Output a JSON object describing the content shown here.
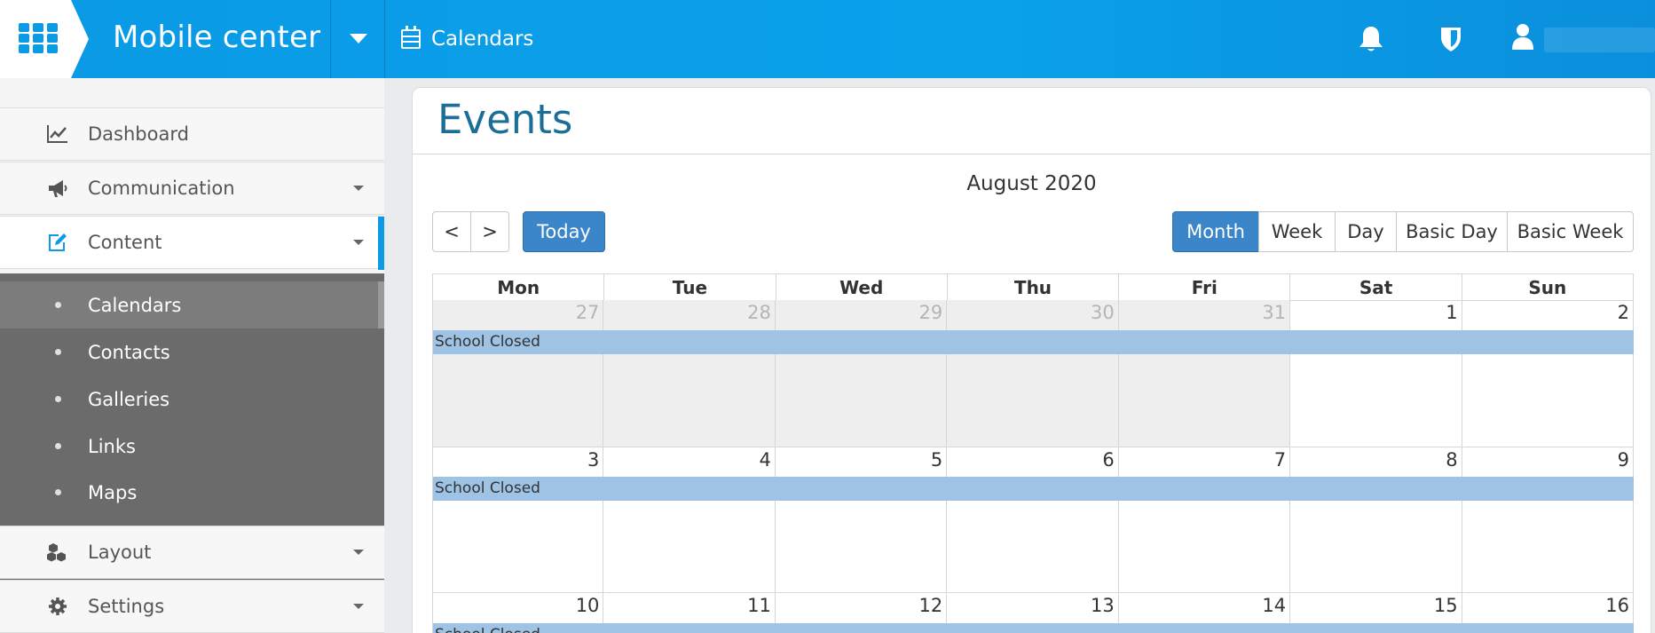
{
  "app": {
    "title": "Mobile center"
  },
  "header": {
    "breadcrumb": "Calendars",
    "icons": [
      "apps-grid-icon",
      "calendar-icon",
      "bell-icon",
      "shield-icon",
      "user-icon"
    ]
  },
  "sidebar": {
    "items": [
      {
        "label": "Dashboard",
        "icon": "line-chart-icon"
      },
      {
        "label": "Communication",
        "icon": "megaphone-icon"
      },
      {
        "label": "Content",
        "icon": "edit-icon"
      },
      {
        "label": "Layout",
        "icon": "cubes-icon"
      },
      {
        "label": "Settings",
        "icon": "gear-icon"
      }
    ],
    "subitems": [
      "Calendars",
      "Contacts",
      "Galleries",
      "Links",
      "Maps"
    ]
  },
  "page": {
    "title": "Events"
  },
  "calendar": {
    "title": "August 2020",
    "prev": "<",
    "next": ">",
    "today": "Today",
    "views": [
      "Month",
      "Week",
      "Day",
      "Basic Day",
      "Basic Week"
    ],
    "active_view": "Month",
    "weekdays": [
      "Mon",
      "Tue",
      "Wed",
      "Thu",
      "Fri",
      "Sat",
      "Sun"
    ],
    "weeks": [
      {
        "days": [
          "27",
          "28",
          "29",
          "30",
          "31",
          "1",
          "2"
        ],
        "event": "School Closed"
      },
      {
        "days": [
          "3",
          "4",
          "5",
          "6",
          "7",
          "8",
          "9"
        ],
        "event": "School Closed"
      },
      {
        "days": [
          "10",
          "11",
          "12",
          "13",
          "14",
          "15",
          "16"
        ],
        "event": "School Closed"
      }
    ]
  },
  "colors": {
    "header": "#0a9ae6",
    "accent": "#3a86c8",
    "title": "#1c6e98",
    "event": "#9ec3e4",
    "sidebar_sub": "#6b6b6b"
  }
}
